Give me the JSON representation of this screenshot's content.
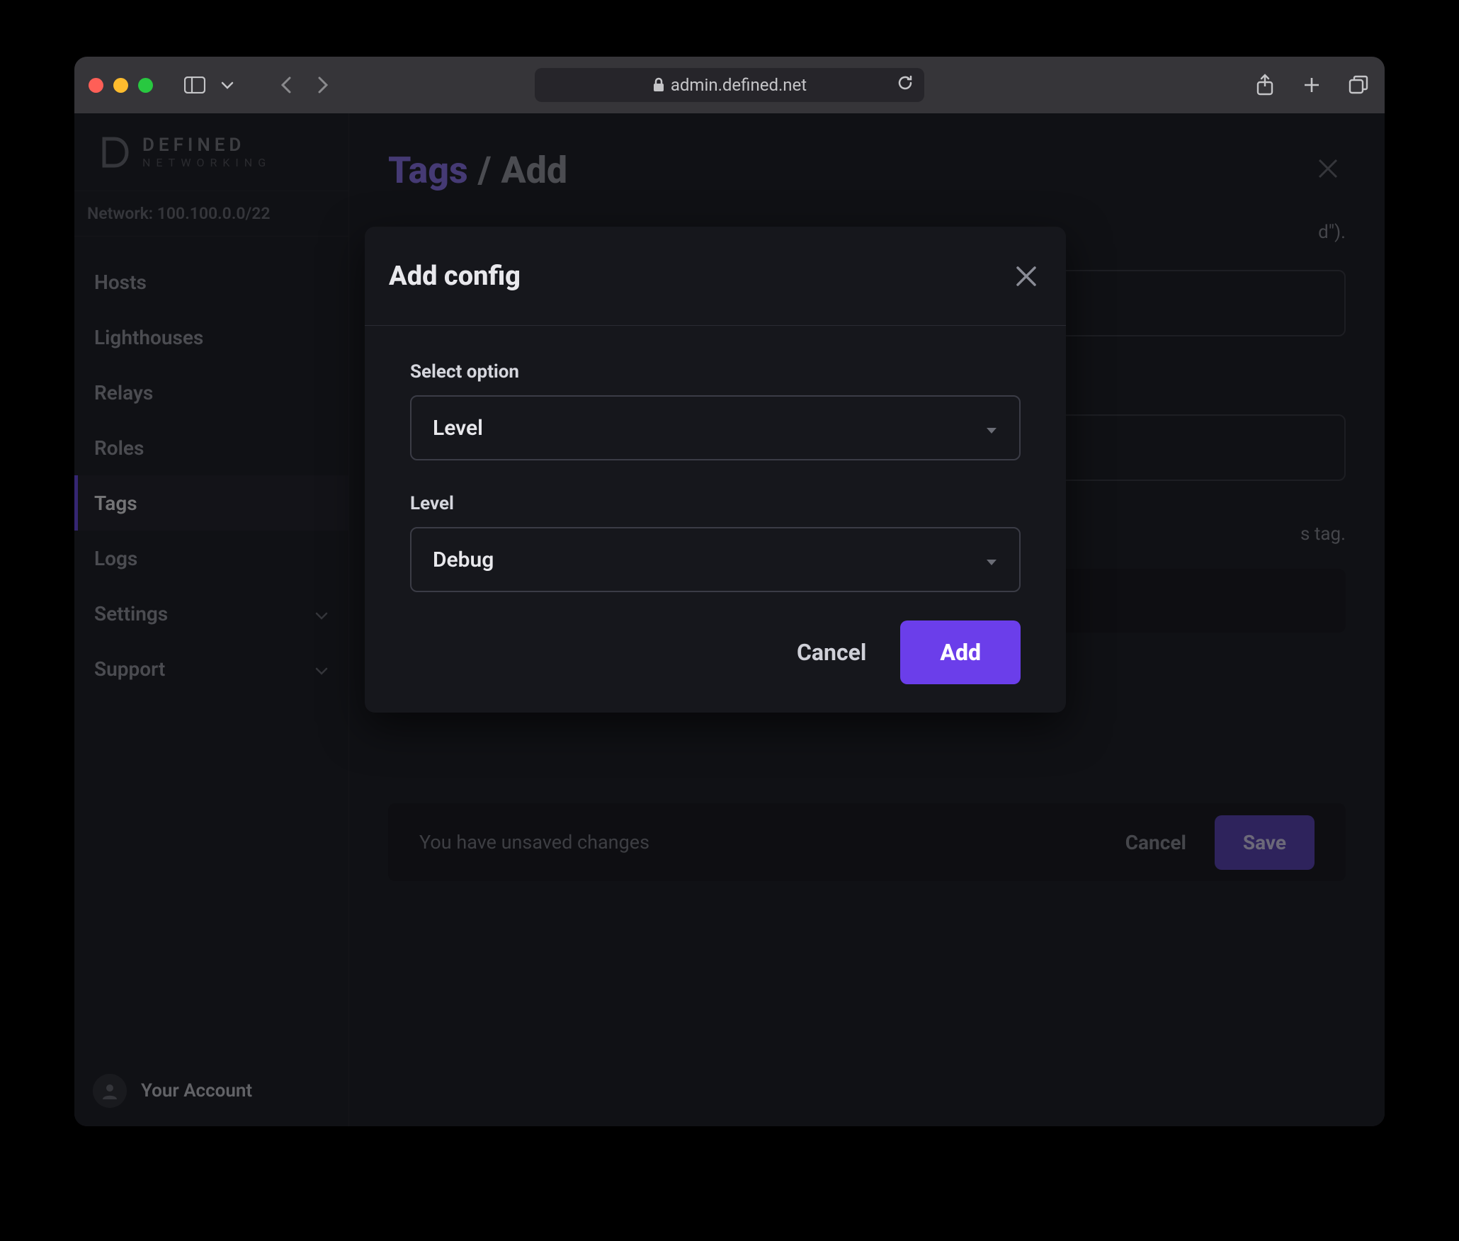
{
  "browser": {
    "url": "admin.defined.net"
  },
  "brand": {
    "name": "DEFINED",
    "subtitle": "NETWORKING"
  },
  "network": {
    "label": "Network: 100.100.0.0/22"
  },
  "sidebar": {
    "items": [
      {
        "label": "Hosts",
        "active": false,
        "expandable": false
      },
      {
        "label": "Lighthouses",
        "active": false,
        "expandable": false
      },
      {
        "label": "Relays",
        "active": false,
        "expandable": false
      },
      {
        "label": "Roles",
        "active": false,
        "expandable": false
      },
      {
        "label": "Tags",
        "active": true,
        "expandable": false
      },
      {
        "label": "Logs",
        "active": false,
        "expandable": false
      },
      {
        "label": "Settings",
        "active": false,
        "expandable": true
      },
      {
        "label": "Support",
        "active": false,
        "expandable": true
      }
    ]
  },
  "account": {
    "label": "Your Account"
  },
  "page": {
    "title_main": "Tags",
    "title_sep": "/",
    "title_sub": "Add",
    "helper_text_suffix": "d\").",
    "config_desc_suffix": "s tag.",
    "add_config_label": "Add config"
  },
  "footer": {
    "unsaved_label": "You have unsaved changes",
    "cancel_label": "Cancel",
    "save_label": "Save"
  },
  "modal": {
    "title": "Add config",
    "field1_label": "Select option",
    "field1_value": "Level",
    "field2_label": "Level",
    "field2_value": "Debug",
    "cancel_label": "Cancel",
    "add_label": "Add"
  }
}
